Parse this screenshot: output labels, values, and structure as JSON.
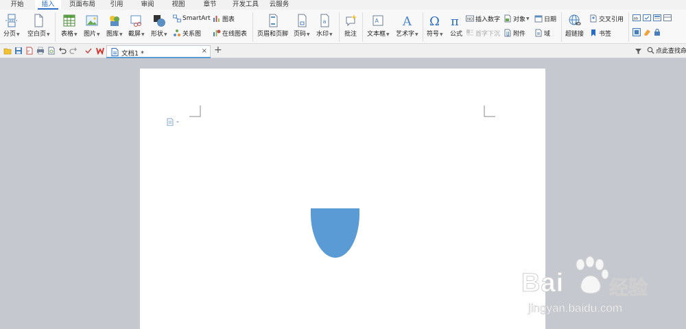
{
  "menu_tabs": [
    "开始",
    "插入",
    "页面布局",
    "引用",
    "审阅",
    "视图",
    "章节",
    "开发工具",
    "云服务"
  ],
  "active_tab": "插入",
  "ribbon": {
    "page_break": "分页",
    "blank_page": "空白页",
    "table": "表格",
    "picture": "图片",
    "gallery": "图库",
    "screenshot": "截屏",
    "shapes": "形状",
    "smartart": "SmartArt",
    "chart": "图表",
    "relation": "关系图",
    "online_chart": "在线图表",
    "header_footer": "页眉和页脚",
    "page_number": "页码",
    "watermark": "水印",
    "comment": "批注",
    "textbox": "文本框",
    "wordart": "艺术字",
    "symbol": "符号",
    "formula": "公式",
    "insert_number": "插入数字",
    "object": "对象",
    "date": "日期",
    "drop_cap": "首字下沉",
    "attachment": "附件",
    "field": "域",
    "hyperlink": "超链接",
    "cross_ref": "交叉引用",
    "bookmark": "书签"
  },
  "toolbar": {
    "doc_title": "文档1 *",
    "close_symbol": "×",
    "new_tab_symbol": "+",
    "find_label": "点此查找命"
  },
  "watermark_text": {
    "brand": "Bai",
    "brand_tail": "经验",
    "url": "jingyan.baidu.com"
  },
  "colors": {
    "accent": "#2b6cc4",
    "shape_fill": "#5b9bd5",
    "canvas_bg": "#c5c8cf"
  },
  "icons": {
    "quick_access": [
      "open-folder-icon",
      "save-icon",
      "pdf-export-icon",
      "print-icon",
      "print-preview-icon",
      "undo-icon",
      "redo-icon",
      "check-icon",
      "wps-logo-icon"
    ],
    "document": "document-icon"
  }
}
